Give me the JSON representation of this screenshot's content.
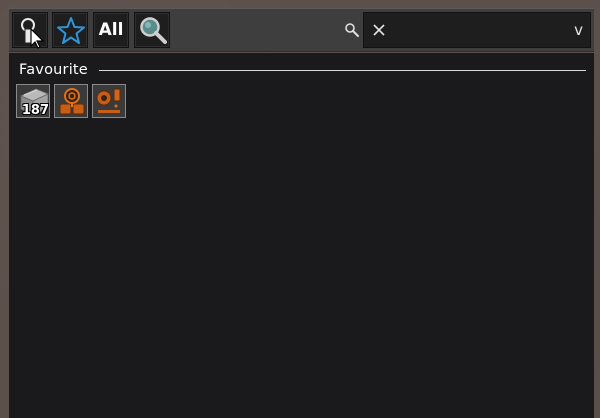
{
  "toolbar": {
    "buttons": [
      {
        "icon": "pipette-cursor-icon"
      },
      {
        "icon": "star-icon",
        "color": "#2f95d8"
      },
      {
        "label": "All"
      },
      {
        "icon": "magnifier-icon"
      }
    ],
    "search": {
      "value": "",
      "clear_icon": "close-icon",
      "dropdown_label": "v"
    }
  },
  "panel": {
    "section_title": "Favourite",
    "items": [
      {
        "icon": "iron-plate-icon",
        "count": "187"
      },
      {
        "icon": "orange-machine-icon",
        "count": ""
      },
      {
        "icon": "orange-component-icon",
        "count": ""
      }
    ]
  },
  "colors": {
    "panel_bg": "#1a191b",
    "toolbar_bg": "#3e3e3e",
    "frame_bg": "#5c504b",
    "accent_orange": "#e0701a"
  }
}
